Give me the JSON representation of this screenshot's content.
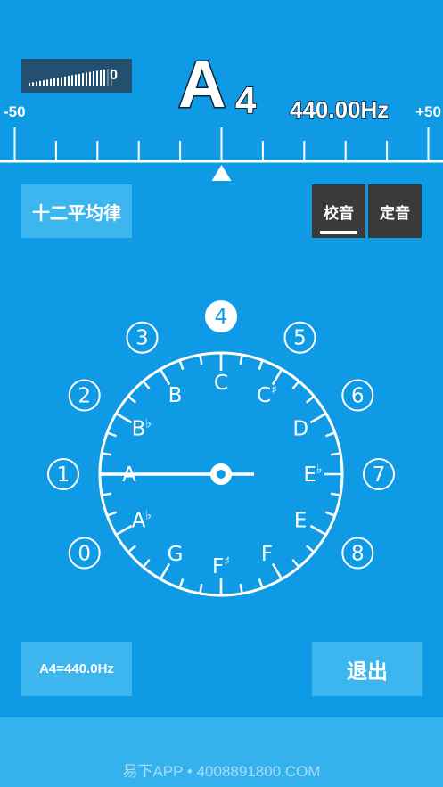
{
  "meter": {
    "level": 0.9,
    "value": "0"
  },
  "note": {
    "letter": "A",
    "octave": "4"
  },
  "frequency": "440.00Hz",
  "cents_scale": {
    "min_label": "-50",
    "max_label": "+50",
    "deviation": 0
  },
  "temperament_button": "十二平均律",
  "mode_tabs": [
    {
      "label": "校音",
      "active": true
    },
    {
      "label": "定音",
      "active": false
    }
  ],
  "octave_selector": {
    "options": [
      "0",
      "1",
      "2",
      "3",
      "4",
      "5",
      "6",
      "7",
      "8"
    ],
    "selected": "4"
  },
  "dial": {
    "notes": [
      {
        "letter": "C",
        "accidental": ""
      },
      {
        "letter": "C",
        "accidental": "♯"
      },
      {
        "letter": "D",
        "accidental": ""
      },
      {
        "letter": "E",
        "accidental": "♭"
      },
      {
        "letter": "E",
        "accidental": ""
      },
      {
        "letter": "F",
        "accidental": ""
      },
      {
        "letter": "F",
        "accidental": "♯"
      },
      {
        "letter": "G",
        "accidental": ""
      },
      {
        "letter": "A",
        "accidental": "♭"
      },
      {
        "letter": "A",
        "accidental": ""
      },
      {
        "letter": "B",
        "accidental": "♭"
      },
      {
        "letter": "B",
        "accidental": ""
      }
    ],
    "selected_note": "A"
  },
  "reference_button": "A4=440.0Hz",
  "exit_button": "退出",
  "footer_text": "易下APP • 4008891800.COM",
  "colors": {
    "background": "#0f9ae6",
    "button": "#3db6f0",
    "dark_button": "#3a3a3a",
    "meter_bg": "#24506f",
    "footer": "#35b2ee"
  }
}
